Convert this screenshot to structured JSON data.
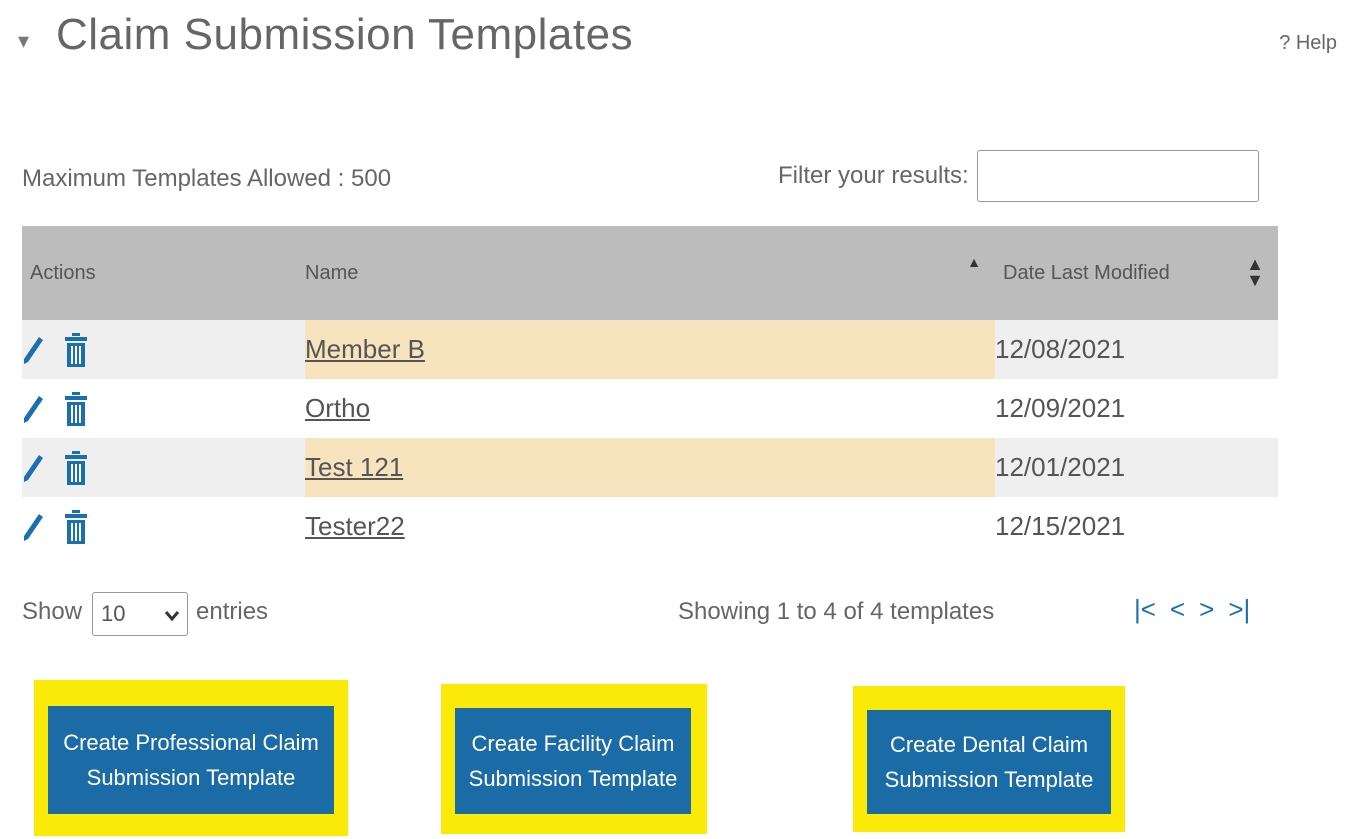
{
  "header": {
    "toggle_glyph": "▾",
    "title": "Claim Submission Templates",
    "help": "? Help"
  },
  "summary": {
    "max_templates": "Maximum Templates Allowed : 500",
    "filter_label": "Filter your results:",
    "filter_value": ""
  },
  "table": {
    "columns": [
      "Actions",
      "Name",
      "Date Last Modified"
    ],
    "rows": [
      {
        "name": "Member B",
        "date": "12/08/2021"
      },
      {
        "name": "Ortho",
        "date": "12/09/2021"
      },
      {
        "name": "Test 121",
        "date": "12/01/2021"
      },
      {
        "name": "Tester22",
        "date": "12/15/2021"
      }
    ]
  },
  "footer": {
    "show_label": "Show",
    "entries_value": "10",
    "entries_label": "entries",
    "showing": "Showing 1 to 4 of 4 templates",
    "pager": [
      "|<",
      "<",
      ">",
      ">|"
    ]
  },
  "buttons": {
    "professional": "Create Professional Claim Submission Template",
    "facility": "Create Facility Claim Submission Template",
    "dental": "Create Dental Claim Submission Template"
  },
  "colors": {
    "header_bg": "#bcbcbc",
    "highlight_row": "#f7e4be",
    "button_bg": "#1b6ca6",
    "callout_yellow": "#fbea07",
    "icon_blue": "#1a6fb0"
  }
}
